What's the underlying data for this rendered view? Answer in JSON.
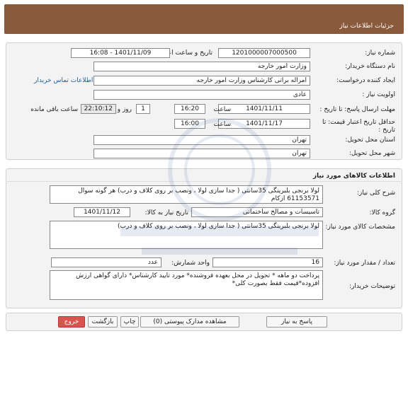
{
  "header": {
    "title": "جزئیات اطلاعات نیاز"
  },
  "info": {
    "need_number_label": "شماره نیاز:",
    "need_number": "1201000007000500",
    "announce_label": "تاریخ و ساعت اعلان عمومی:",
    "announce_value": "1401/11/09 - 16:08",
    "buyer_org_label": "نام دستگاه خریدار:",
    "buyer_org": "وزارت امور خارجه",
    "requester_label": "ایجاد کننده درخواست:",
    "requester": "امراله براتی کارشناس وزارت امور خارجه",
    "buyer_contact_link": "اطلاعات تماس خریدار",
    "priority_label": "اولویت نیاز :",
    "priority": "عادی",
    "deadline_label": "مهلت ارسال پاسخ: تا تاریخ :",
    "deadline_date": "1401/11/11",
    "time_label": "ساعت",
    "deadline_time": "16:20",
    "days_value": "1",
    "days_label": "روز و",
    "remaining_time": "22:10:12",
    "remaining_label": "ساعت باقی مانده",
    "validity_label": "حداقل تاریخ اعتبار قیمت: تا تاریخ :",
    "validity_date": "1401/11/17",
    "validity_time": "16:00",
    "province_label": "استان محل تحویل:",
    "province": "تهران",
    "city_label": "شهر محل تحویل:",
    "city": "تهران"
  },
  "goods": {
    "section_title": "اطلاعات کالاهای مورد نیاز",
    "summary_label": "شرح کلی نیاز:",
    "summary": "لولا برنجی بلبرینگی 35سانتی ( جدا سازی لولا ، ونصب بر روی کلاف و درب) هر گونه سوال 61153571 ازکام",
    "group_label": "گروه کالا:",
    "group": "تاسیسات و مصالح ساختمانی",
    "need_date_label": "تاریخ نیاز به کالا:",
    "need_date": "1401/11/12",
    "spec_label": "مشخصات کالای مورد نیاز:",
    "spec": "لولا برنجی بلبرینگی 35سانتی ( جدا سازی لولا ، ونصب بر روی کلاف و درب)",
    "qty_label": "تعداد / مقدار مورد نیاز:",
    "qty": "16",
    "unit_label": "واحد شمارش:",
    "unit": "عدد",
    "notes_label": "توضیحات خریدار:",
    "notes": "پرداخت دو ماهه * تحویل در محل بعهده فروشنده* مورد تایید کارشناس* دارای گواهی ارزش افزوده*قیمت فقط بصورت کلی*"
  },
  "buttons": {
    "reply": "پاسخ به نیاز",
    "attachments": "مشاهده مدارک پیوستی (0)",
    "print": "چاپ",
    "back": "بازگشت",
    "exit": "خروج"
  },
  "colors": {
    "header_bg": "#8a5a3c",
    "exit_btn": "#d9534f",
    "link": "#1a5fa8"
  }
}
